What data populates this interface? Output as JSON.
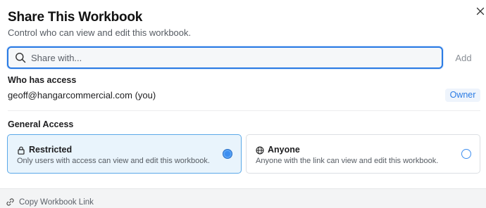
{
  "dialog": {
    "title": "Share This Workbook",
    "subtitle": "Control who can view and edit this workbook."
  },
  "search": {
    "placeholder": "Share with...",
    "value": ""
  },
  "add_button": "Add",
  "who_has_access": {
    "heading": "Who has access",
    "members": [
      {
        "email": "geoff@hangarcommercial.com (you)",
        "role": "Owner"
      }
    ]
  },
  "general_access": {
    "heading": "General Access",
    "options": [
      {
        "label": "Restricted",
        "description": "Only users with access can view and edit this workbook.",
        "icon": "lock-icon",
        "selected": true
      },
      {
        "label": "Anyone",
        "description": "Anyone with the link can view and edit this workbook.",
        "icon": "globe-icon",
        "selected": false
      }
    ]
  },
  "footer": {
    "copy_link": "Copy Workbook Link",
    "icon": "link-icon"
  },
  "colors": {
    "accent": "#2a7be4",
    "selected_bg": "#e9f4fc",
    "footer_bg": "#f3f4f5"
  }
}
